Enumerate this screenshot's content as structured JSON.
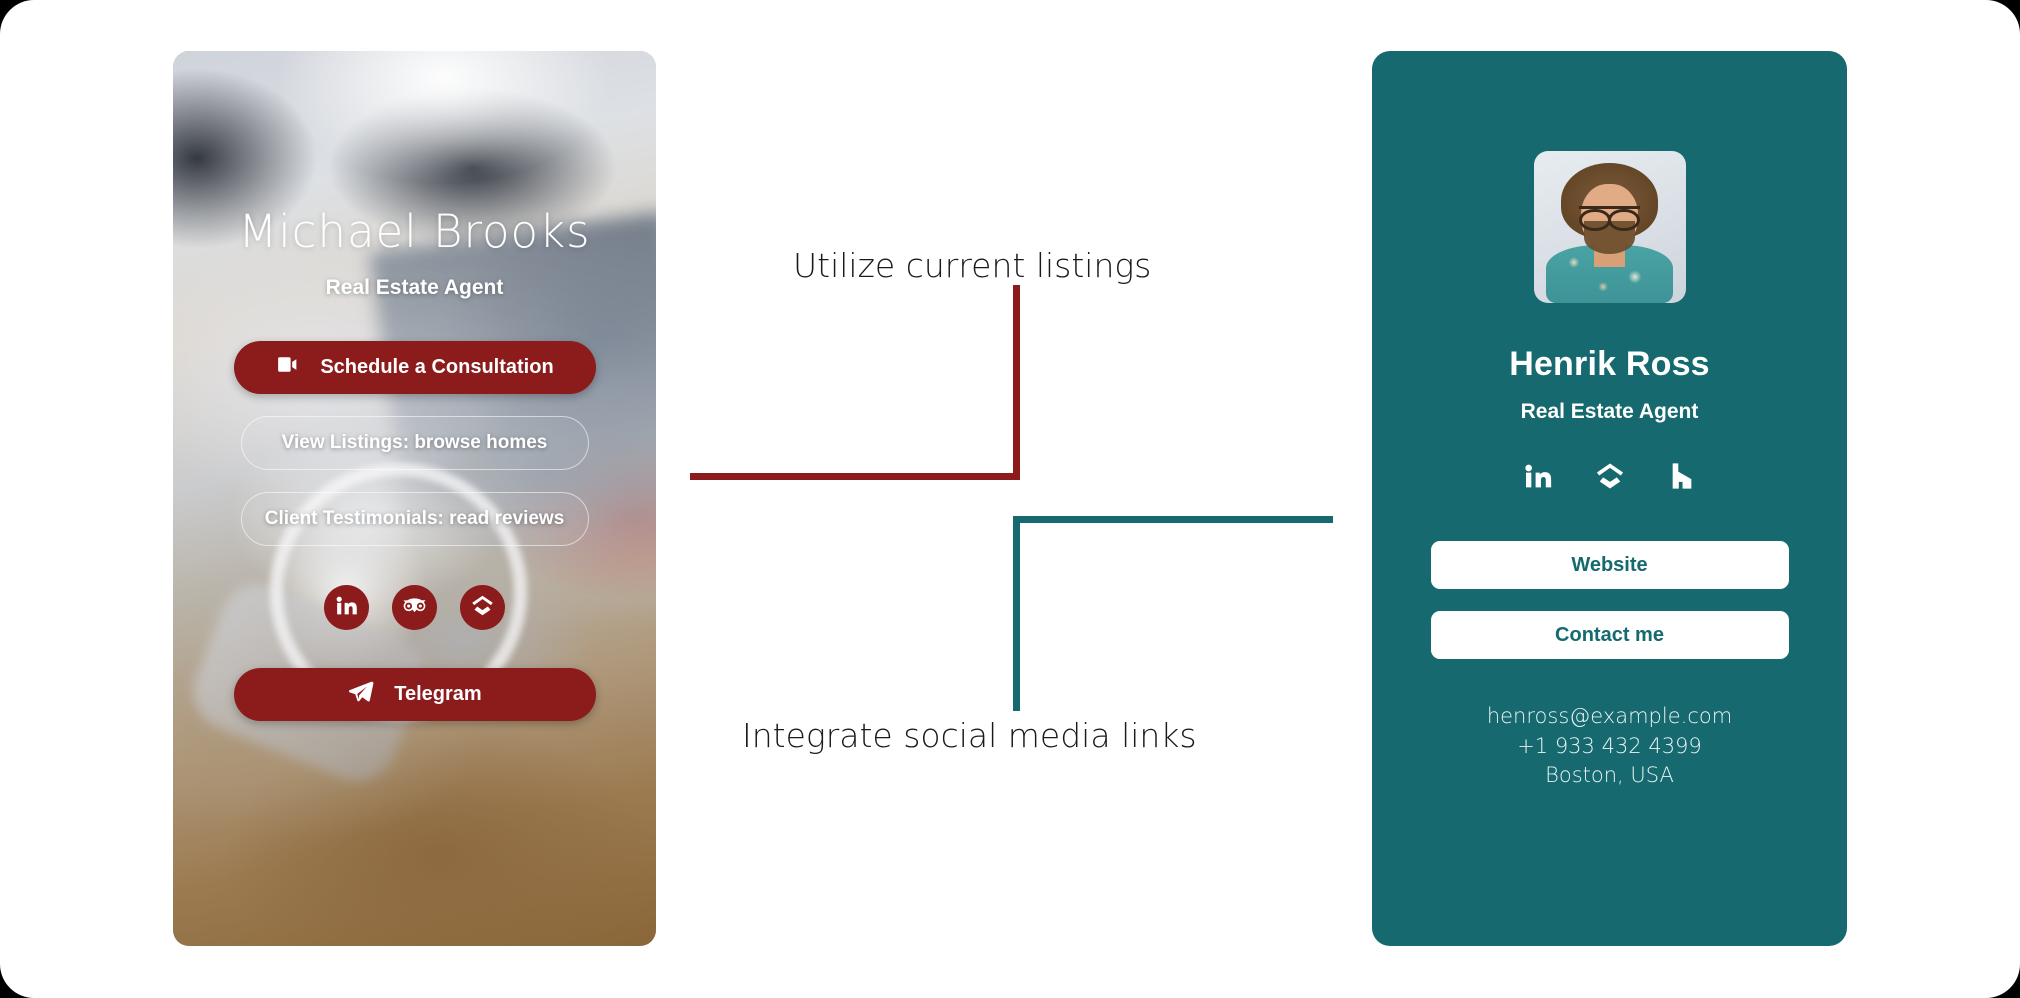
{
  "left_card": {
    "name": "Michael Brooks",
    "role": "Real Estate Agent",
    "schedule_button": "Schedule a Consultation",
    "schedule_icon": "video-camera-icon",
    "listings_button": "View Listings: browse homes",
    "testimonials_button": "Client Testimonials: read reviews",
    "social_icons": [
      "linkedin-icon",
      "tripadvisor-icon",
      "zillow-icon"
    ],
    "telegram_button": "Telegram",
    "telegram_icon": "telegram-paper-plane-icon",
    "accent_color": "#8c1b1b"
  },
  "right_card": {
    "avatar": "profile-photo",
    "name": "Henrik Ross",
    "role": "Real Estate Agent",
    "social_icons": [
      "linkedin-icon",
      "zillow-icon",
      "houzz-icon"
    ],
    "website_button": "Website",
    "contact_button": "Contact me",
    "email": "henross@example.com",
    "phone": "+1 933 432 4399",
    "location": "Boston, USA",
    "accent_color": "#16696e",
    "button_text_color": "#16696e"
  },
  "annotations": {
    "top": {
      "label": "Utilize current listings",
      "line_color": "#8c1b1b"
    },
    "bottom": {
      "label": "Integrate social media links",
      "line_color": "#16696e"
    }
  },
  "canvas": {
    "background": "#ffffff",
    "outer_background": "#000000"
  }
}
